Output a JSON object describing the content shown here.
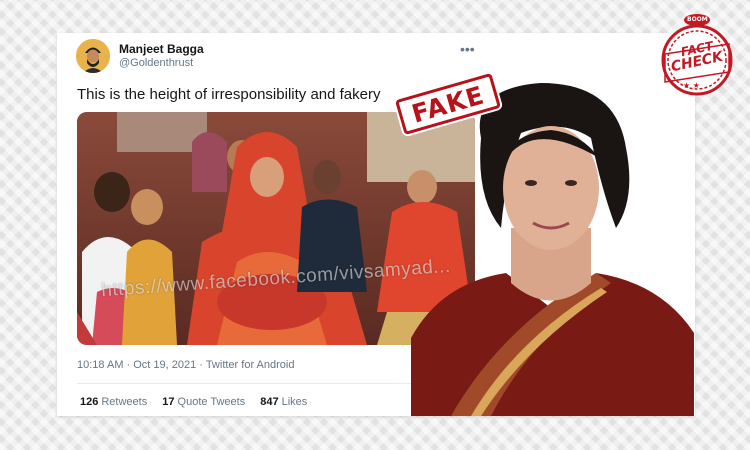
{
  "tweet": {
    "author_name": "Manjeet Bagga",
    "author_handle": "@Goldenthrust",
    "text": "This is the height of irresponsibility and fakery",
    "photo_watermark": "https://www.facebook.com/vivsamyad...",
    "timestamp": "10:18 AM · Oct 19, 2021 · Twitter for Android",
    "stats": [
      {
        "count": "126",
        "label": "Retweets"
      },
      {
        "count": "17",
        "label": "Quote Tweets"
      },
      {
        "count": "847",
        "label": "Likes"
      }
    ],
    "more_icon": "more-horizontal-icon"
  },
  "stamp": {
    "text": "FAKE",
    "color": "#b7121a"
  },
  "badge": {
    "brand": "BOOM",
    "line1": "FACT",
    "line2": "CHECK",
    "color": "#c21a24"
  }
}
